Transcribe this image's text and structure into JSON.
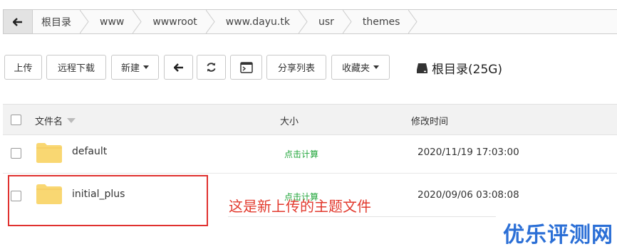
{
  "breadcrumb": {
    "items": [
      "根目录",
      "www",
      "wwwroot",
      "www.dayu.tk",
      "usr",
      "themes"
    ]
  },
  "toolbar": {
    "upload": "上传",
    "remote_download": "远程下载",
    "new": "新建",
    "share_list": "分享列表",
    "favorites": "收藏夹",
    "disk_label": "根目录(25G)"
  },
  "table": {
    "headers": {
      "name": "文件名",
      "size": "大小",
      "mtime": "修改时间"
    },
    "rows": [
      {
        "name": "default",
        "size": "点击计算",
        "mtime": "2020/11/19 17:03:00"
      },
      {
        "name": "initial_plus",
        "size": "点击计算",
        "mtime": "2020/09/06 03:08:08"
      }
    ]
  },
  "annotation": "这是新上传的主题文件",
  "watermark": "优乐评测网",
  "colors": {
    "folder": "#f9d772",
    "calc": "#20a53a",
    "highlight": "#e0312f",
    "watermark": "#2b6fd6"
  }
}
